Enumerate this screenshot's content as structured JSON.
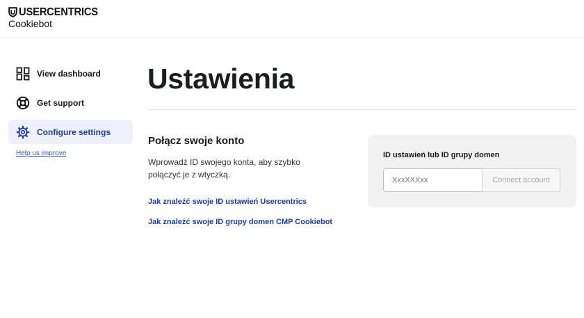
{
  "brand": {
    "name": "USERCENTRICS",
    "product": "Cookiebot",
    "logo_icon": "shield-logo-icon"
  },
  "sidebar": {
    "items": [
      {
        "label": "View dashboard",
        "icon": "dashboard-grid-icon",
        "active": false
      },
      {
        "label": "Get support",
        "icon": "lifebuoy-icon",
        "active": false
      },
      {
        "label": "Configure settings",
        "icon": "gear-icon",
        "active": true
      }
    ],
    "help_link": "Help us improve"
  },
  "page": {
    "title": "Ustawienia"
  },
  "connect_section": {
    "title": "Połącz swoje konto",
    "description": "Wprowadź ID swojego konta, aby szybko połączyć je z wtyczką.",
    "links": [
      "Jak znaleźć swoje ID ustawień Usercentrics",
      "Jak znaleźć swoje ID grupy domen CMP Cookiebot"
    ]
  },
  "account_card": {
    "label": "ID ustawień lub ID grupy domen",
    "input_placeholder": "XxxXXXxx",
    "input_value": "",
    "button_label": "Connect account"
  },
  "colors": {
    "accent": "#1d3fa3",
    "active_bg": "#eef0fa",
    "card_bg": "#f2f2f2"
  }
}
